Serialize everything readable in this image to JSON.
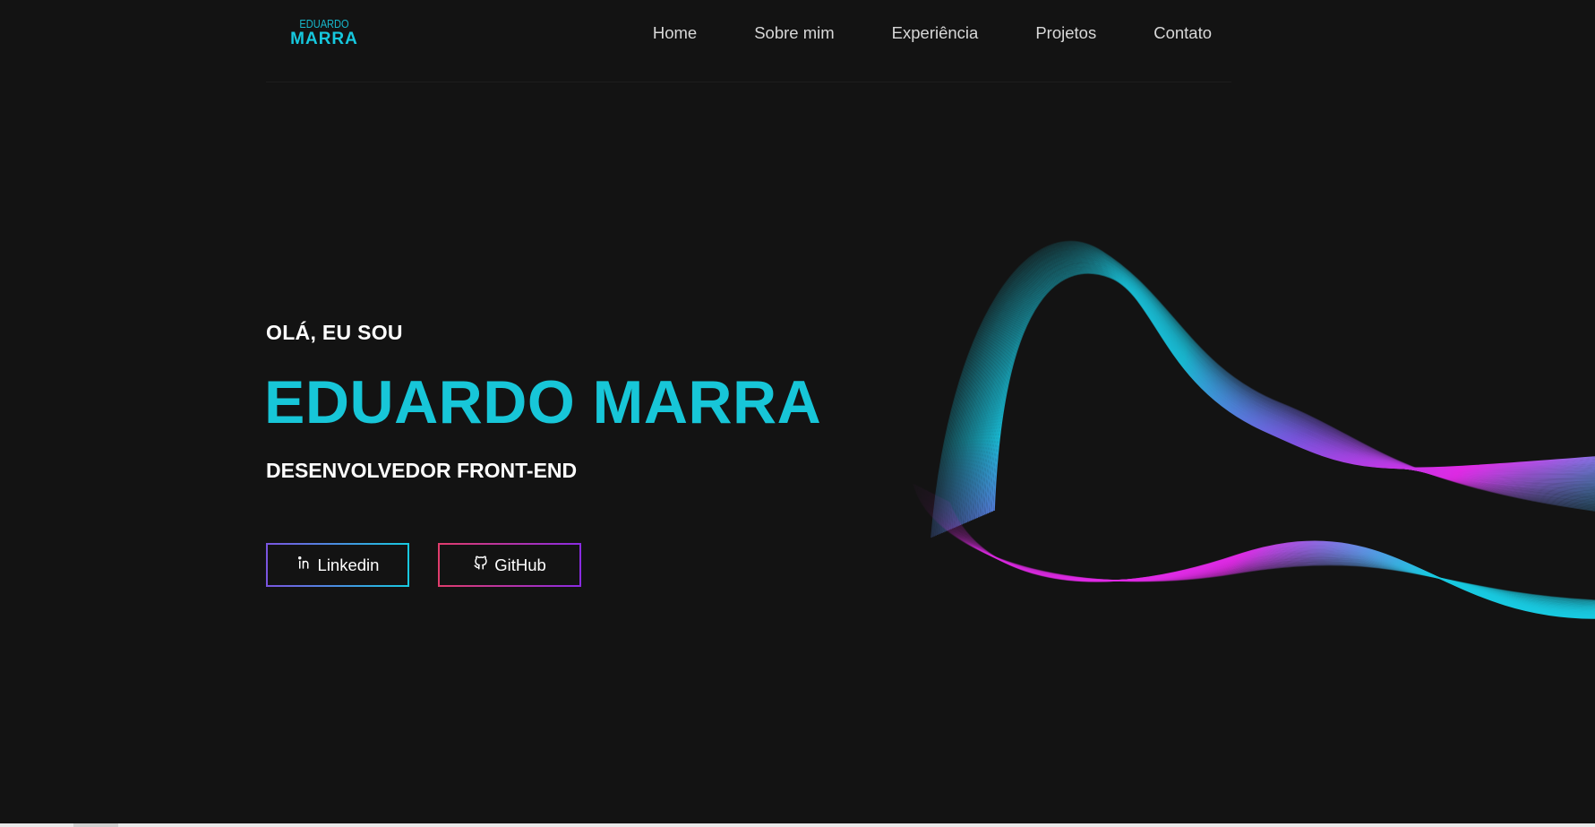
{
  "logo": {
    "top": "EDUARDO",
    "bottom": "MARRA"
  },
  "nav": [
    {
      "label": "Home"
    },
    {
      "label": "Sobre mim"
    },
    {
      "label": "Experiência"
    },
    {
      "label": "Projetos"
    },
    {
      "label": "Contato"
    }
  ],
  "hero": {
    "greeting": "OLÁ, EU SOU",
    "name": "EDUARDO MARRA",
    "role": "DESENVOLVEDOR FRONT-END"
  },
  "buttons": {
    "linkedin": {
      "label": "Linkedin",
      "icon": "linkedin-icon"
    },
    "github": {
      "label": "GitHub",
      "icon": "github-icon"
    }
  },
  "colors": {
    "background": "#131313",
    "accent": "#17c6d8",
    "wave_cyan": "#18c9e0",
    "wave_purple": "#7a55e0",
    "wave_magenta": "#e02ae6"
  }
}
